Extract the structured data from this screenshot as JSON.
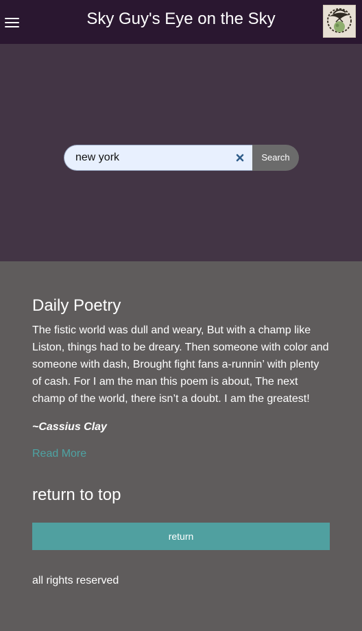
{
  "header": {
    "title": "Sky Guy's Eye on the Sky",
    "menu_icon": "hamburger-menu-icon",
    "avatar_icon": "bird-logo"
  },
  "search": {
    "value": "new york",
    "clear_icon": "close-icon",
    "button_label": "Search"
  },
  "poetry": {
    "heading": "Daily Poetry",
    "text": "The fistic world was dull and weary, But with a champ like Liston, things had to be dreary. Then someone with color and someone with dash, Brought fight fans a-runnin’ with plenty of cash. For I am the man this poem is about, The next champ of the world, there isn’t a doubt. I am the greatest!",
    "author": "~Cassius Clay",
    "read_more": "Read More"
  },
  "return_section": {
    "heading": "return to top",
    "button_label": "return"
  },
  "footer": {
    "text": "all rights reserved"
  },
  "colors": {
    "header_bg": "#2a1730",
    "hero_bg": "#433545",
    "body_bg": "#5f5c5c",
    "accent": "#50a0a0",
    "link": "#4ea3a3"
  }
}
